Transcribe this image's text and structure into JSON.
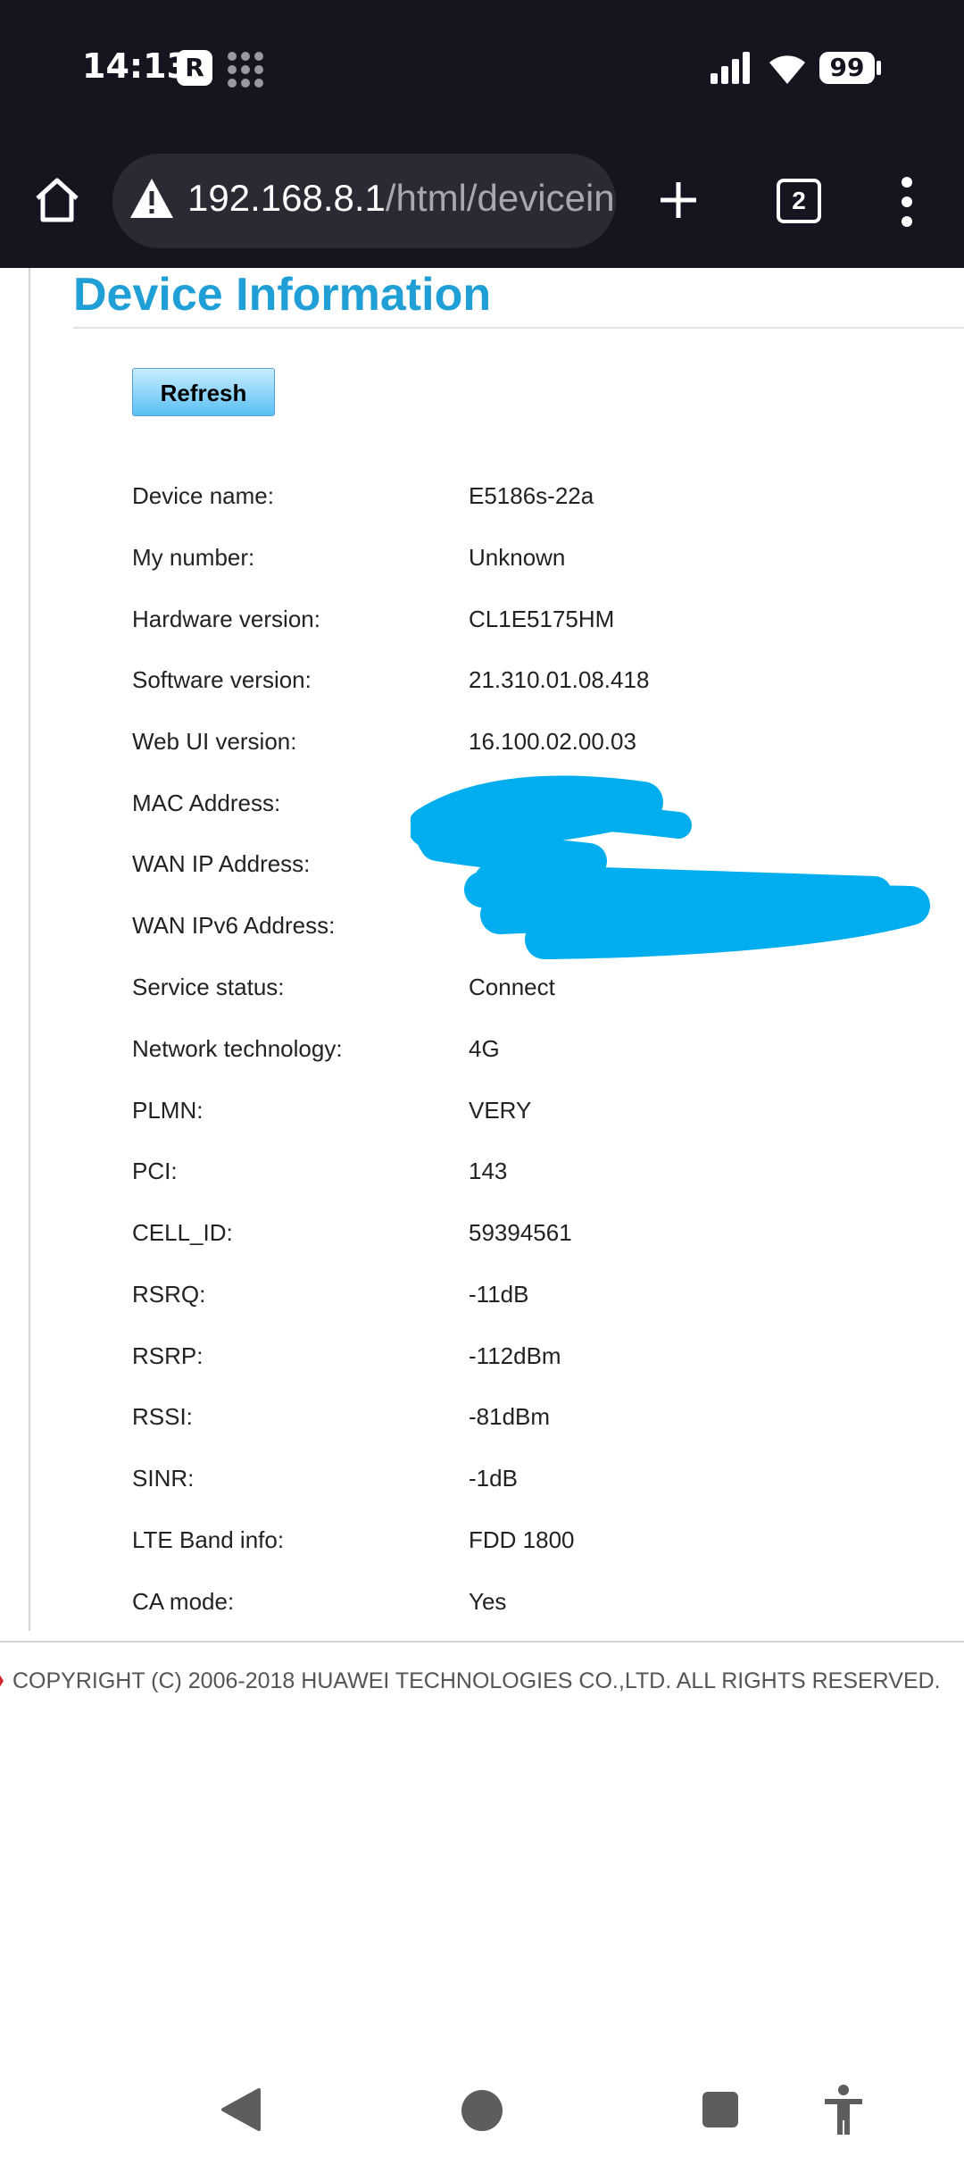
{
  "status_bar": {
    "time": "14:13",
    "app_icon_letter": "R",
    "battery": "99"
  },
  "browser": {
    "url_host": "192.168.8.1",
    "url_path": "/html/devicein",
    "tab_count": "2"
  },
  "page": {
    "title": "Device Information",
    "refresh_label": "Refresh",
    "rows": [
      {
        "label": "Device name:",
        "value": "E5186s-22a"
      },
      {
        "label": "My number:",
        "value": "Unknown"
      },
      {
        "label": "Hardware version:",
        "value": "CL1E5175HM"
      },
      {
        "label": "Software version:",
        "value": "21.310.01.08.418"
      },
      {
        "label": "Web UI version:",
        "value": "16.100.02.00.03"
      },
      {
        "label": "MAC Address:",
        "value": ""
      },
      {
        "label": "WAN IP Address:",
        "value": ""
      },
      {
        "label": "WAN IPv6 Address:",
        "value": ""
      },
      {
        "label": "Service status:",
        "value": "Connect"
      },
      {
        "label": "Network technology:",
        "value": "4G"
      },
      {
        "label": "PLMN:",
        "value": "VERY"
      },
      {
        "label": "PCI:",
        "value": "143"
      },
      {
        "label": "CELL_ID:",
        "value": "59394561"
      },
      {
        "label": "RSRQ:",
        "value": "-11dB"
      },
      {
        "label": "RSRP:",
        "value": "-112dBm"
      },
      {
        "label": "RSSI:",
        "value": "-81dBm"
      },
      {
        "label": "SINR:",
        "value": "-1dB"
      },
      {
        "label": "LTE Band info:",
        "value": "FDD 1800"
      },
      {
        "label": "CA mode:",
        "value": "Yes"
      }
    ],
    "copyright": "COPYRIGHT (C) 2006-2018 HUAWEI TECHNOLOGIES CO.,LTD. ALL RIGHTS RESERVED."
  },
  "colors": {
    "title": "#1f9fd5",
    "redaction": "#00aef0",
    "chrome_bg": "#17141f"
  },
  "icons": [
    "home-icon",
    "warning-icon",
    "plus-icon",
    "tabs-icon",
    "more-vert-icon",
    "back-icon",
    "home-circle-icon",
    "recents-icon",
    "accessibility-icon"
  ]
}
